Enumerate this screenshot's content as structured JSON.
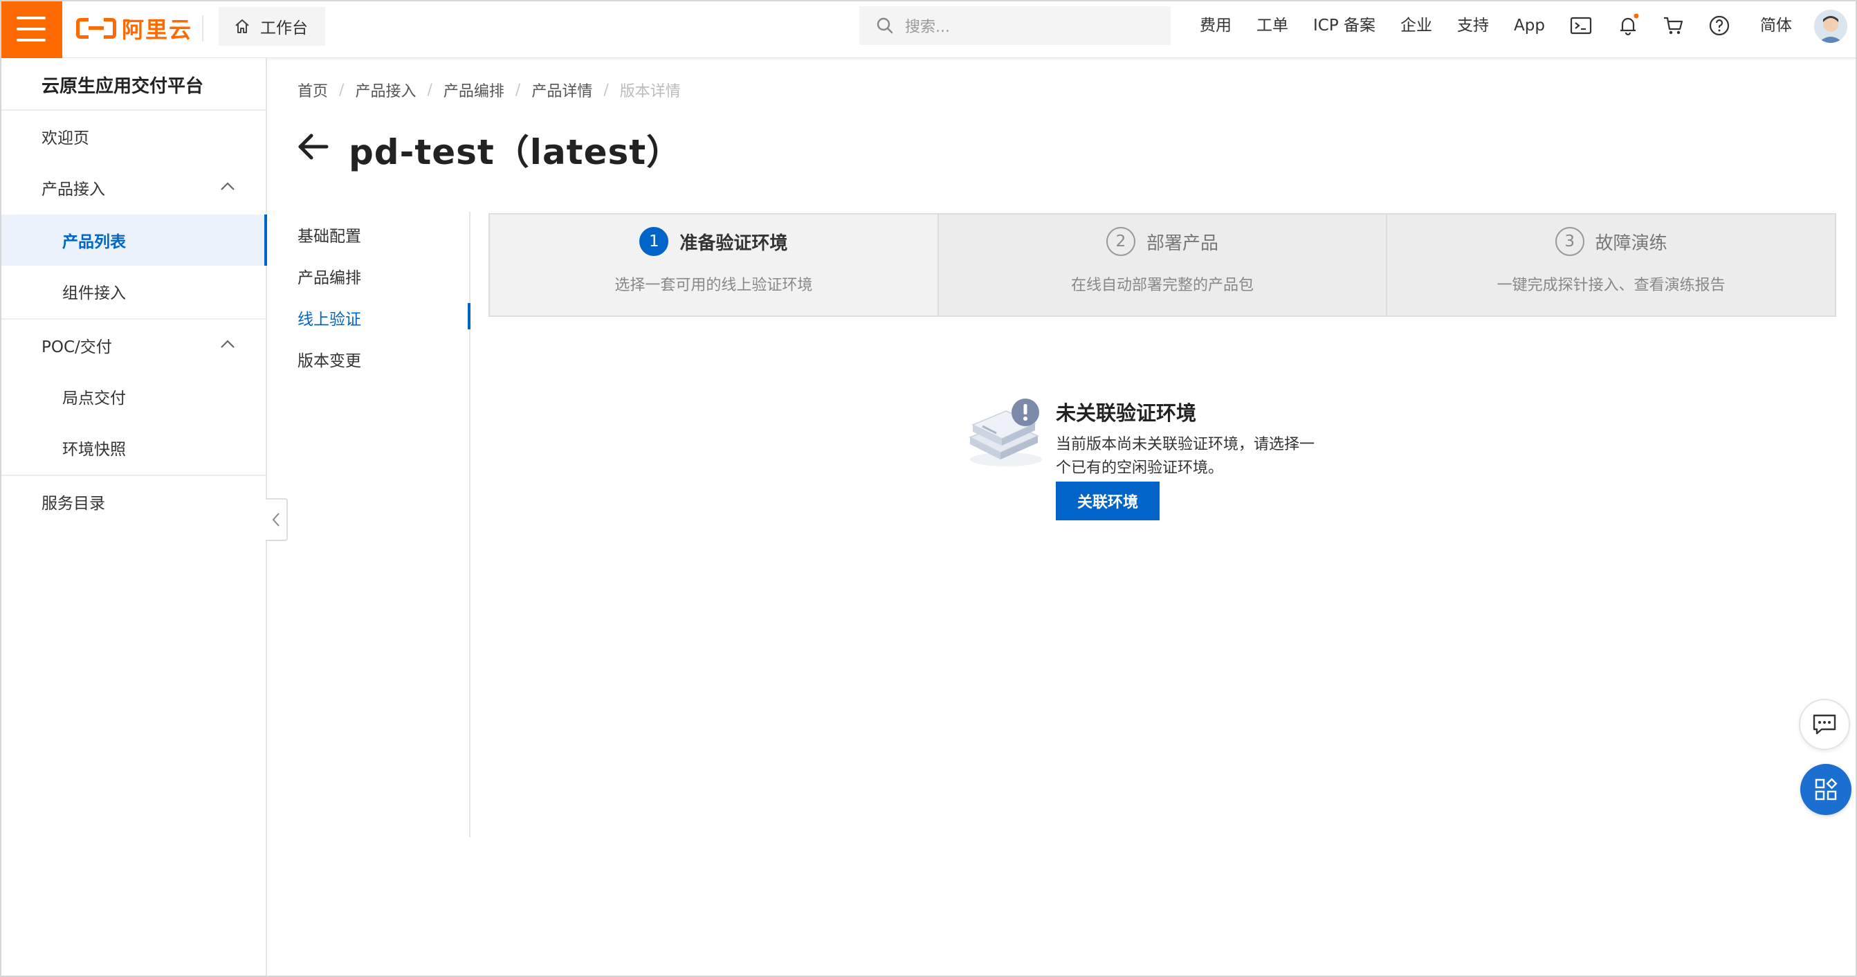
{
  "header": {
    "logo_text": "阿里云",
    "workbench_label": "工作台",
    "search_placeholder": "搜索...",
    "links": {
      "billing": "费用",
      "ticket": "工单",
      "icp": "ICP 备案",
      "enterprise": "企业",
      "support": "支持",
      "app": "App"
    },
    "language": "简体"
  },
  "sidebar": {
    "title": "云原生应用交付平台",
    "welcome": "欢迎页",
    "group_product": "产品接入",
    "product_list": "产品列表",
    "component_access": "组件接入",
    "group_poc": "POC/交付",
    "local_delivery": "局点交付",
    "env_snapshot": "环境快照",
    "service_catalog": "服务目录"
  },
  "breadcrumb": {
    "home": "首页",
    "product_access": "产品接入",
    "product_orchestration": "产品编排",
    "product_detail": "产品详情",
    "version_detail": "版本详情"
  },
  "page": {
    "title": "pd-test（latest）"
  },
  "subnav": {
    "basic_config": "基础配置",
    "orchestration": "产品编排",
    "online_verify": "线上验证",
    "version_change": "版本变更"
  },
  "steps": [
    {
      "num": "1",
      "title": "准备验证环境",
      "desc": "选择一套可用的线上验证环境",
      "active": true
    },
    {
      "num": "2",
      "title": "部署产品",
      "desc": "在线自动部署完整的产品包",
      "active": false
    },
    {
      "num": "3",
      "title": "故障演练",
      "desc": "一键完成探针接入、查看演练报告",
      "active": false
    }
  ],
  "empty_state": {
    "title": "未关联验证环境",
    "description": "当前版本尚未关联验证环境，请选择一个已有的空闲验证环境。",
    "button": "关联环境"
  },
  "colors": {
    "brand_orange": "#ff6a00",
    "primary_blue": "#0064c8",
    "notification_dot": "#ff6a00"
  }
}
